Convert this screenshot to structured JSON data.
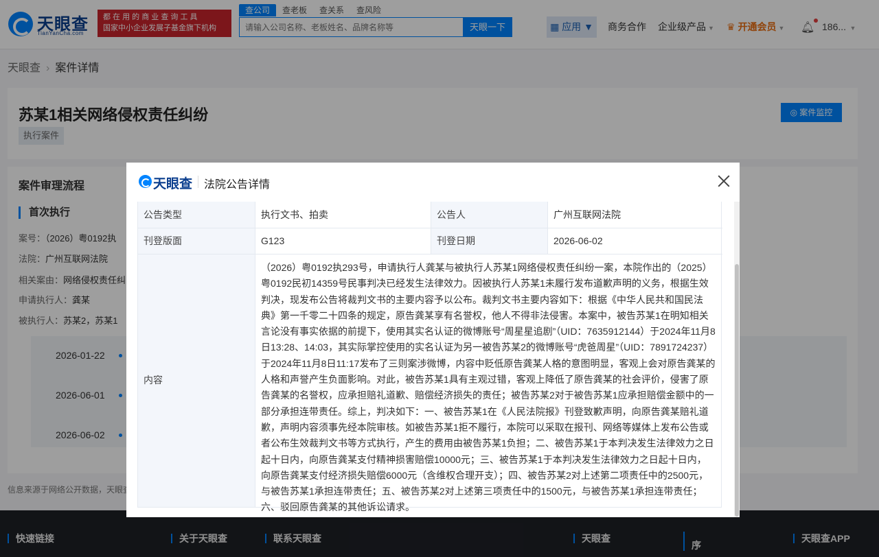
{
  "header": {
    "logo_name": "天眼查",
    "logo_domain": "TianYanCha.com",
    "slogan_line1": "都 在 用 的 商 业 查 询 工 具",
    "slogan_line2": "国家中小企业发展子基金旗下机构",
    "search_tabs": [
      "查公司",
      "查老板",
      "查关系",
      "查风险"
    ],
    "search_placeholder": "请输入公司名称、老板姓名、品牌名称等",
    "search_button": "天眼一下",
    "app_button": "应用",
    "nav_business": "商务合作",
    "nav_enterprise": "企业级产品",
    "nav_vip": "开通会员",
    "user": "186..."
  },
  "breadcrumb": {
    "home": "天眼查",
    "current": "案件详情"
  },
  "case": {
    "title": "苏某1相关网络侵权责任纠纷",
    "tag": "执行案件",
    "monitor_button": "案件监控"
  },
  "process": {
    "title": "案件审理流程",
    "stage": "首次执行",
    "fields": [
      {
        "label": "案号：",
        "value": "（2026）粤0192执"
      },
      {
        "label": "法院：",
        "value": "广州互联网法院"
      },
      {
        "label": "相关案由：",
        "value": "网络侵权责任纠"
      },
      {
        "label": "申请执行人：",
        "value": "龚某"
      },
      {
        "label": "被执行人：",
        "value": "苏某2，苏某1"
      }
    ],
    "timeline": [
      "2026-01-22",
      "2026-06-01",
      "2026-06-02"
    ]
  },
  "source_note": "信息来源于网络公开数据，天眼查",
  "footer": {
    "links": [
      "快速链接",
      "关于天眼查",
      "联系天眼查",
      "天眼查",
      "序",
      "天眼查APP"
    ]
  },
  "modal": {
    "logo_name": "天眼查",
    "title": "法院公告详情",
    "rows": [
      {
        "label1": "公告类型",
        "value1": "执行文书、拍卖",
        "label2": "公告人",
        "value2": "广州互联网法院"
      },
      {
        "label1": "刊登版面",
        "value1": "G123",
        "label2": "刊登日期",
        "value2": "2026-06-02"
      }
    ],
    "content_label": "内容",
    "content": "（2026）粤0192执293号，申请执行人龚某与被执行人苏某1网络侵权责任纠纷一案，本院作出的（2025）粤0192民初14359号民事判决已经发生法律效力。因被执行人苏某1未履行发布道歉声明的义务，根据生效判决，现发布公告将裁判文书的主要内容予以公布。裁判文书主要内容如下：根据《中华人民共和国民法典》第一千零二十四条的规定，原告龚某享有名誉权，他人不得非法侵害。本案中，被告苏某1在明知相关言论没有事实依据的前提下，使用其实名认证的微博账号“周星星追剧”（UID：7635912144）于2024年11月8日13:28、14:03，其实际掌控使用的实名认证为另一被告苏某2的微博账号“虎爸周星”（UID：7891724237）于2024年11月8日11:17发布了三则案涉微博，内容中贬低原告龚某人格的意图明显，客观上会对原告龚某的人格和声誉产生负面影响。对此，被告苏某1具有主观过错，客观上降低了原告龚某的社会评价，侵害了原告龚某的名誉权，应承担赔礼道歉、赔偿经济损失的责任；被告苏某2对于被告苏某1应承担赔偿金额中的一部分承担连带责任。综上，判决如下：一、被告苏某1在《人民法院报》刊登致歉声明，向原告龚某赔礼道歉，声明内容须事先经本院审核。如被告苏某1拒不履行，本院可以采取在报刊、网络等媒体上发布公告或者公布生效裁判文书等方式执行，产生的费用由被告苏某1负担；二、被告苏某1于本判决发生法律效力之日起十日内，向原告龚某支付精神损害赔偿10000元；三、被告苏某1于本判决发生法律效力之日起十日内，向原告龚某支付经济损失赔偿6000元（含维权合理开支）；四、被告苏某2对上述第二项责任中的2500元，与被告苏某1承担连带责任；五、被告苏某2对上述第三项责任中的1500元，与被告苏某1承担连带责任；六、驳回原告龚某的其他诉讼请求。"
  },
  "colors": {
    "brand_blue": "#0084ff",
    "slogan_red": "#c8242c",
    "vip_orange": "#e86d11",
    "footer_bg": "#1e2126"
  }
}
